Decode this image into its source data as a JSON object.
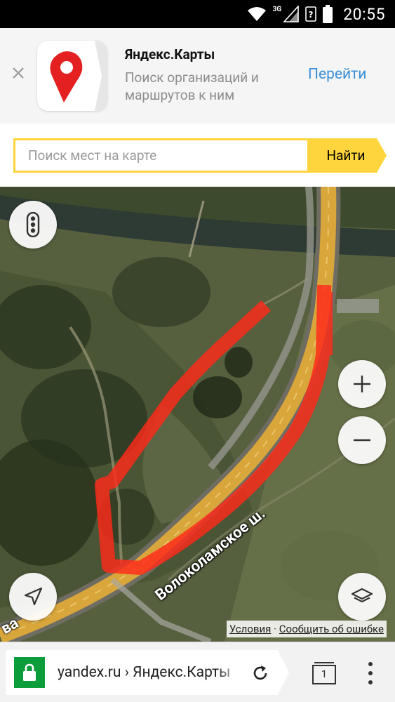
{
  "status_bar": {
    "network": "3G",
    "time": "20:55",
    "icons": [
      "wifi-icon",
      "signal-icon",
      "sim-unknown-icon",
      "battery-icon"
    ]
  },
  "app_banner": {
    "title": "Яндекс.Карты",
    "description": "Поиск организаций и маршрутов к ним",
    "action": "Перейти",
    "icon": "yandex-maps-pin-icon",
    "colors": {
      "action": "#3a8fd8",
      "pin": "#e52020"
    }
  },
  "search": {
    "placeholder": "Поиск мест на карте",
    "value": "",
    "button_label": "Найти",
    "colors": {
      "accent": "#ffd53d"
    }
  },
  "map": {
    "road_label": "Волоколамское ш.",
    "road_label_partial": "ва",
    "controls": [
      "traffic-icon",
      "zoom-in-icon",
      "zoom-out-icon",
      "my-location-icon",
      "layers-icon"
    ],
    "attribution": {
      "terms": "Условия",
      "separator": "·",
      "report": "Сообщить об ошибке"
    },
    "colors": {
      "road": "#d9a63c",
      "route_highlight": "#ff2a1a"
    }
  },
  "browser": {
    "url": "yandex.ru › Яндекс.Карты",
    "tab_count": "1",
    "colors": {
      "lock": "#0b9d3a"
    }
  }
}
